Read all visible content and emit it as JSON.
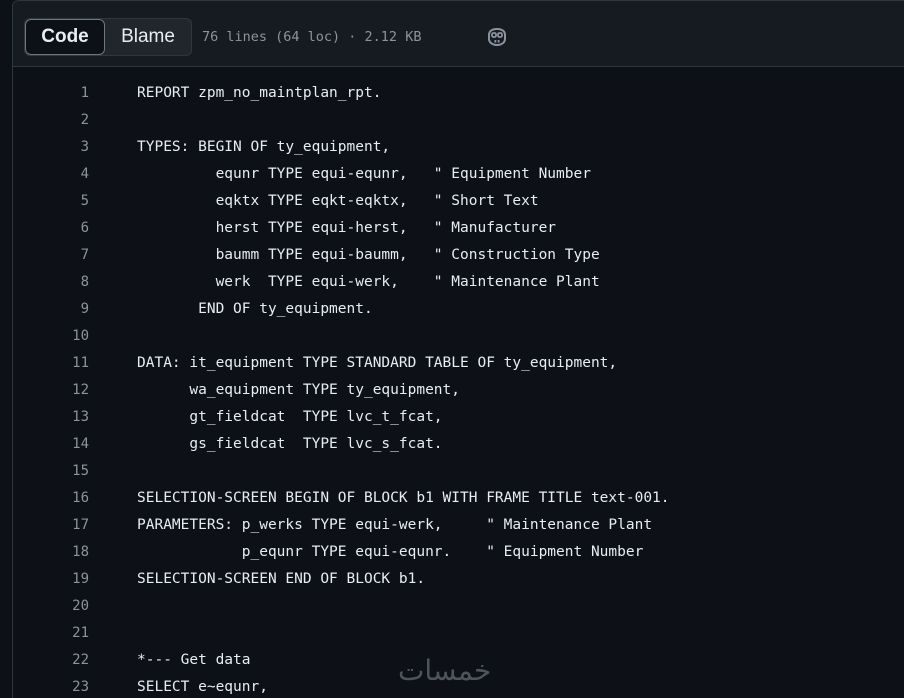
{
  "toolbar": {
    "tabs": [
      {
        "label": "Code",
        "active": true
      },
      {
        "label": "Blame",
        "active": false
      }
    ],
    "file_meta": "76 lines (64 loc) · 2.12 KB",
    "copilot_icon": "copilot-icon"
  },
  "code": {
    "lines": [
      {
        "num": "1",
        "text": "REPORT zpm_no_maintplan_rpt."
      },
      {
        "num": "2",
        "text": ""
      },
      {
        "num": "3",
        "text": "TYPES: BEGIN OF ty_equipment,"
      },
      {
        "num": "4",
        "text": "         equnr TYPE equi-equnr,   \" Equipment Number"
      },
      {
        "num": "5",
        "text": "         eqktx TYPE eqkt-eqktx,   \" Short Text"
      },
      {
        "num": "6",
        "text": "         herst TYPE equi-herst,   \" Manufacturer"
      },
      {
        "num": "7",
        "text": "         baumm TYPE equi-baumm,   \" Construction Type"
      },
      {
        "num": "8",
        "text": "         werk  TYPE equi-werk,    \" Maintenance Plant"
      },
      {
        "num": "9",
        "text": "       END OF ty_equipment."
      },
      {
        "num": "10",
        "text": ""
      },
      {
        "num": "11",
        "text": "DATA: it_equipment TYPE STANDARD TABLE OF ty_equipment,"
      },
      {
        "num": "12",
        "text": "      wa_equipment TYPE ty_equipment,"
      },
      {
        "num": "13",
        "text": "      gt_fieldcat  TYPE lvc_t_fcat,"
      },
      {
        "num": "14",
        "text": "      gs_fieldcat  TYPE lvc_s_fcat."
      },
      {
        "num": "15",
        "text": ""
      },
      {
        "num": "16",
        "text": "SELECTION-SCREEN BEGIN OF BLOCK b1 WITH FRAME TITLE text-001."
      },
      {
        "num": "17",
        "text": "PARAMETERS: p_werks TYPE equi-werk,     \" Maintenance Plant"
      },
      {
        "num": "18",
        "text": "            p_equnr TYPE equi-equnr.    \" Equipment Number"
      },
      {
        "num": "19",
        "text": "SELECTION-SCREEN END OF BLOCK b1."
      },
      {
        "num": "20",
        "text": ""
      },
      {
        "num": "21",
        "text": ""
      },
      {
        "num": "22",
        "text": "*--- Get data"
      },
      {
        "num": "23",
        "text": "SELECT e~equnr,"
      }
    ]
  },
  "watermark": "خمسات"
}
